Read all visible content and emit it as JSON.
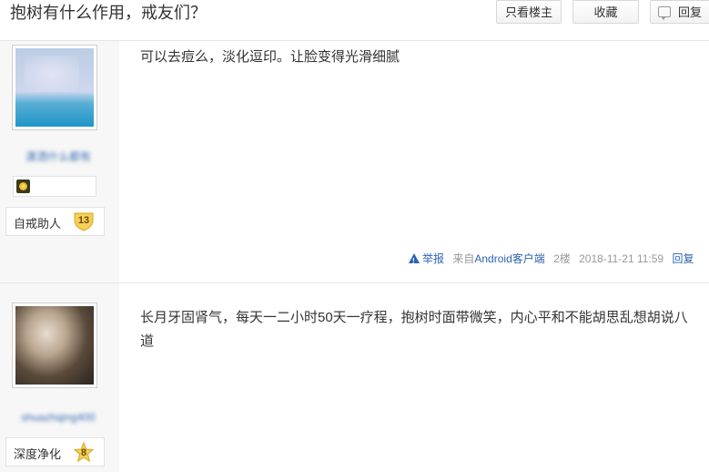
{
  "header": {
    "title": "抱树有什么作用，戒友们？",
    "btn_only_lz": "只看楼主",
    "btn_favorite": "收藏",
    "btn_reply": "回复"
  },
  "posts": [
    {
      "username": "潇洒什么都有",
      "content": "可以去痘么，淡化逗印。让脸变得光滑细腻",
      "level_name": "自戒助人",
      "level_num": "13",
      "tail": {
        "report": "举报",
        "from_prefix": "来自",
        "client": "Android客户端",
        "floor": "2楼",
        "time": "2018-11-21 11:59",
        "reply": "回复"
      }
    },
    {
      "username": "shuazhqing400",
      "content": "长月牙固肾气，每天一二小时50天一疗程，抱树时面带微笑，内心平和不能胡思乱想胡说八道",
      "level_name": "深度净化",
      "level_num": "8"
    }
  ],
  "colors": {
    "link": "#2d64b3",
    "sidebar_bg": "#f7f7f7",
    "badge_gold": "#f2c94c"
  }
}
